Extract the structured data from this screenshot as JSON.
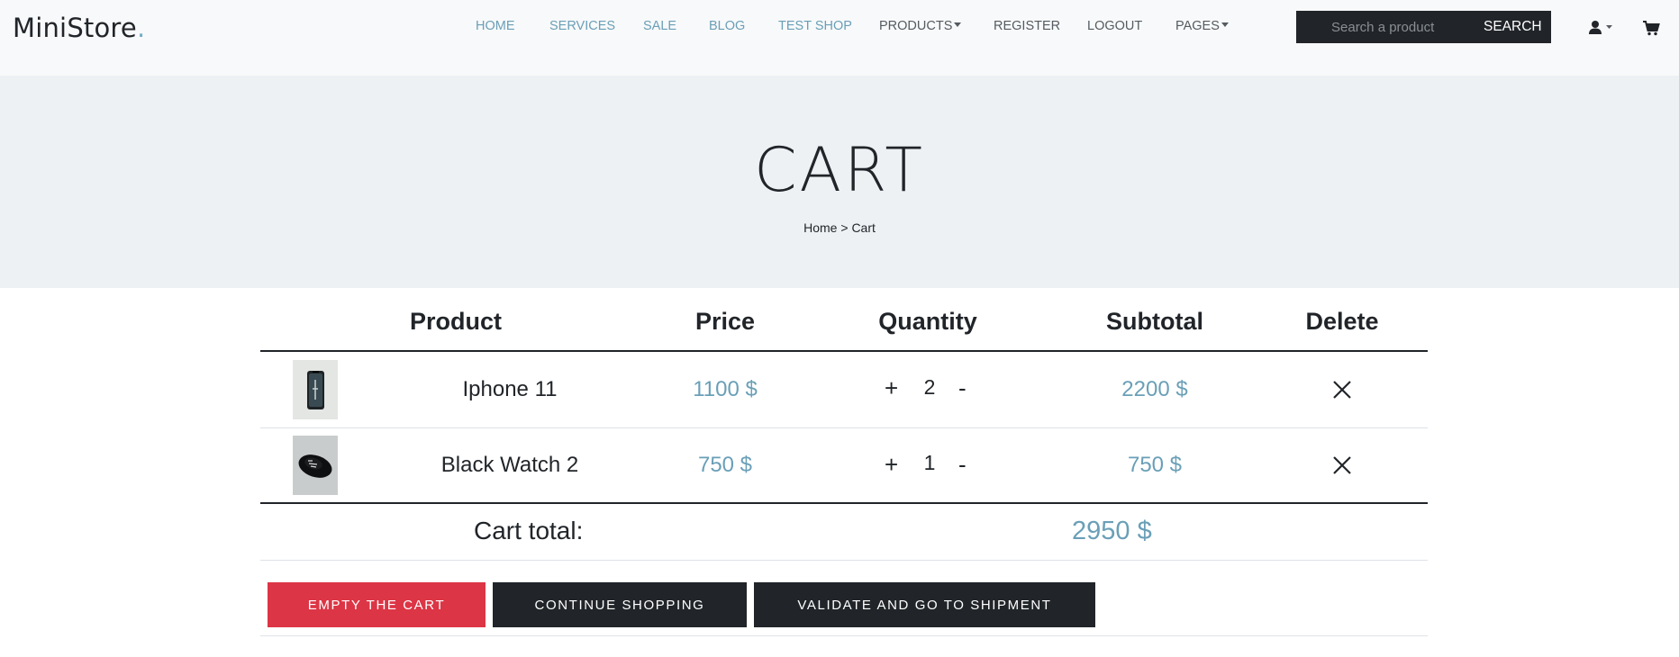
{
  "logo": {
    "text": "MiniStore",
    "dot": "."
  },
  "nav": [
    {
      "label": "HOME",
      "color": "#6a9fb7"
    },
    {
      "label": "SERVICES",
      "color": "#6a9fb7"
    },
    {
      "label": "SALE",
      "color": "#6a9fb7"
    },
    {
      "label": "BLOG",
      "color": "#6a9fb7"
    },
    {
      "label": "TEST SHOP",
      "color": "#6a9fb7"
    },
    {
      "label": "PRODUCTS",
      "color": "#555b61",
      "dropdown": true
    },
    {
      "label": "REGISTER",
      "color": "#555b61"
    },
    {
      "label": "LOGOUT",
      "color": "#555b61"
    },
    {
      "label": "PAGES",
      "color": "#555b61",
      "dropdown": true
    }
  ],
  "search": {
    "placeholder": "Search a product",
    "button": "SEARCH"
  },
  "icons": {
    "user": "user-icon",
    "cart": "cart-icon"
  },
  "hero": {
    "title": "CART",
    "breadcrumb_home": "Home",
    "breadcrumb_separator": ">",
    "breadcrumb_current": "Cart"
  },
  "table": {
    "headers": [
      "Product",
      "Price",
      "Quantity",
      "Subtotal",
      "Delete"
    ],
    "rows": [
      {
        "name": "Iphone 11",
        "price": "1100 $",
        "quantity": "2",
        "subtotal": "2200 $",
        "image": "iphone-thumbnail"
      },
      {
        "name": "Black Watch 2",
        "price": "750 $",
        "quantity": "1",
        "subtotal": "750 $",
        "image": "watch-thumbnail"
      }
    ],
    "plus": "+",
    "minus": "-"
  },
  "total": {
    "label": "Cart total:",
    "value": "2950 $"
  },
  "buttons": {
    "empty": "EMPTY THE CART",
    "continue": "CONTINUE SHOPPING",
    "validate": "VALIDATE AND GO TO SHIPMENT"
  },
  "colors": {
    "accent": "#6a9fb7",
    "danger": "#dc3545",
    "dark": "#212529",
    "hero_bg": "#edf1f4",
    "header_bg": "#f8f9fa"
  }
}
